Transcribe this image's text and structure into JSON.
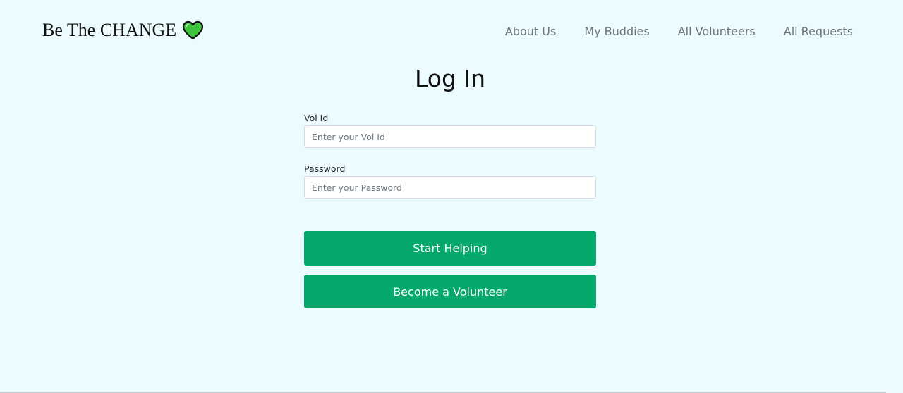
{
  "brand": {
    "name": "Be The CHANGE",
    "icon": "green-heart-icon",
    "icon_color": "#3cc43c"
  },
  "nav": {
    "items": [
      {
        "label": "About Us"
      },
      {
        "label": "My Buddies"
      },
      {
        "label": "All Volunteers"
      },
      {
        "label": "All Requests"
      }
    ]
  },
  "page": {
    "title": "Log In"
  },
  "form": {
    "vol_id": {
      "label": "Vol Id",
      "placeholder": "Enter your Vol Id",
      "value": ""
    },
    "password": {
      "label": "Password",
      "placeholder": "Enter your Password",
      "value": ""
    },
    "submit_label": "Start Helping",
    "register_label": "Become a Volunteer"
  },
  "colors": {
    "background": "#ebfbfe",
    "button": "#05a96b",
    "nav_text": "#6c757d"
  }
}
